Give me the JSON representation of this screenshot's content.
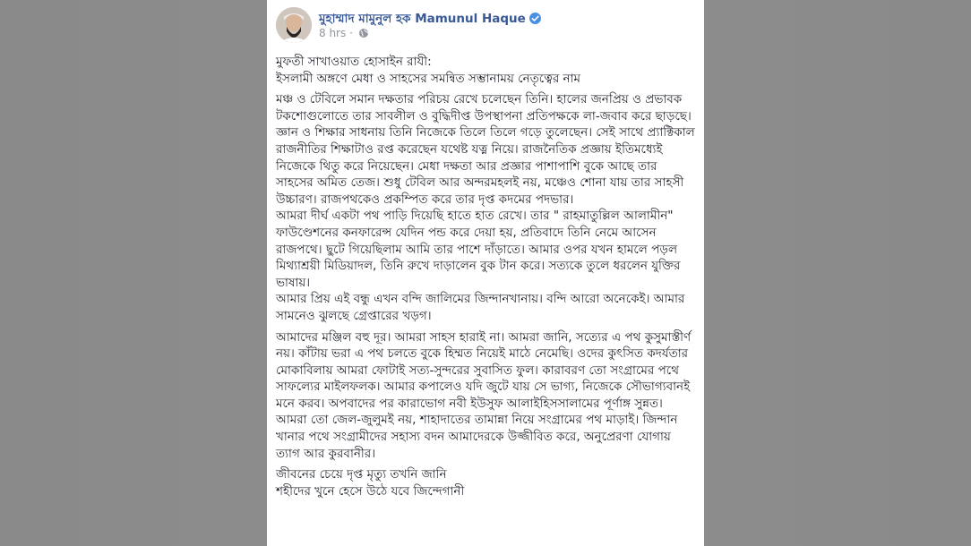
{
  "post": {
    "author": "মুহাম্মাদ মামুনুল হক Mamunul Haque",
    "time": "8 hrs",
    "separator": "·",
    "verified_icon": "verified-check-icon",
    "privacy_icon": "globe-icon",
    "paragraphs": [
      "মুফতী সাখাওয়াত হোসাইন রাযী:\nইসলামী অঙ্গণে মেধা ও সাহসের সমন্বিত সম্ভানাময় নেতৃত্বের নাম",
      "মঞ্চ ও টেবিলে সমান দক্ষতার পরিচয় রেখে চলেছেন তিনি। হালের জনপ্রিয় ও প্রভাবক টকশোগুলোতে তার সাবলীল ও বুদ্ধিদীপ্ত উপস্থাপনা প্রতিপক্ষকে লা-জবাব করে ছাড়ছে। জ্ঞান ও শিক্ষার সাধনায় তিনি নিজেকে তিলে তিলে গড়ে তুলেছেন। সেই সাথে প্র্যাক্টিকাল রাজনীতির শিক্ষাটাও রপ্ত করেছেন যথেষ্ট যত্ন নিয়ে। রাজনৈতিক প্রজ্ঞায় ইতিমধ্যেই নিজেকে থিতু করে নিয়েছেন। মেধা দক্ষতা আর প্রজ্ঞার পাশাপাশি বুকে আছে তার সাহসের অমিত তেজ। শুধু টেবিল আর অন্দরমহলই নয়, মঞ্চেও শোনা যায় তার সাহসী উচ্চারণ। রাজপথকেও প্রকম্পিত করে তার দৃপ্ত কদমের পদভার।\nআমরা দীর্ঘ একটা পথ পাড়ি দিয়েছি হাতে হাত রেখে। তার \" রাহমাতুল্লিল আলামীন\" ফাউণ্ডেশনের কনফারেন্স যেদিন পন্ড করে দেয়া হয়, প্রতিবাদে তিনি নেমে আসেন রাজপথে। ছুটে গিয়েছিলাম আমি তার পাশে দাঁড়াতে। আমার ওপর যখন হামলে পড়ল মিথ্যাশ্রয়ী মিডিয়াদল, তিনি রুখে দাড়ালেন বুক টান করে। সত্যকে তুলে ধরলেন যুক্তির ভাষায়।\nআমার প্রিয় এই বন্ধু এখন বন্দি জালিমের জিন্দানখানায়। বন্দি আরো অনেকেই। আমার সামনেও ঝুলছে গ্রেপ্তারের খড়গ।",
      "আমাদের মঞ্জিল বহু দূর। আমরা সাহস হারাই না। আমরা জানি, সত্যের এ পথ কুসুমাস্তীর্ণ নয়। কাঁটায় ভরা এ পথ চলতে বুকে হিম্মত নিয়েই মাঠে নেমেছি। ওদের কুৎসিত কদর্যতার মোকাবিলায় আমরা ফোটাই সত্য-সুন্দরের সুবাসিত ফুল। কারাবরণ তো সংগ্রামের পথে সাফল্যের মাইলফলক। আমার কপালেও যদি জুটে যায় সে ভাগ্য, নিজেকে সৌভাগ্যবানই মনে করব। অপবাদের পর কারাভোগ নবী ইউসুফ আলাইহিসসালামের পূর্ণাঙ্গ সুন্নত। আমরা তো জেল-জুলুমই নয়, শাহাদাতের তামান্না নিয়ে সংগ্রামের পথ মাড়াই। জিন্দান খানার পথে সংগ্রামীদের সহাস্য বদন আমাদেরকে উজ্জীবিত করে, অনুপ্রেরণা যোগায় ত্যাগ আর কুরবানীর।",
      "জীবনের চেয়ে দৃপ্ত মৃত্যু তখনি জানি\nশহীদের খুনে হেসে উঠে যবে জিন্দেগানী"
    ]
  }
}
